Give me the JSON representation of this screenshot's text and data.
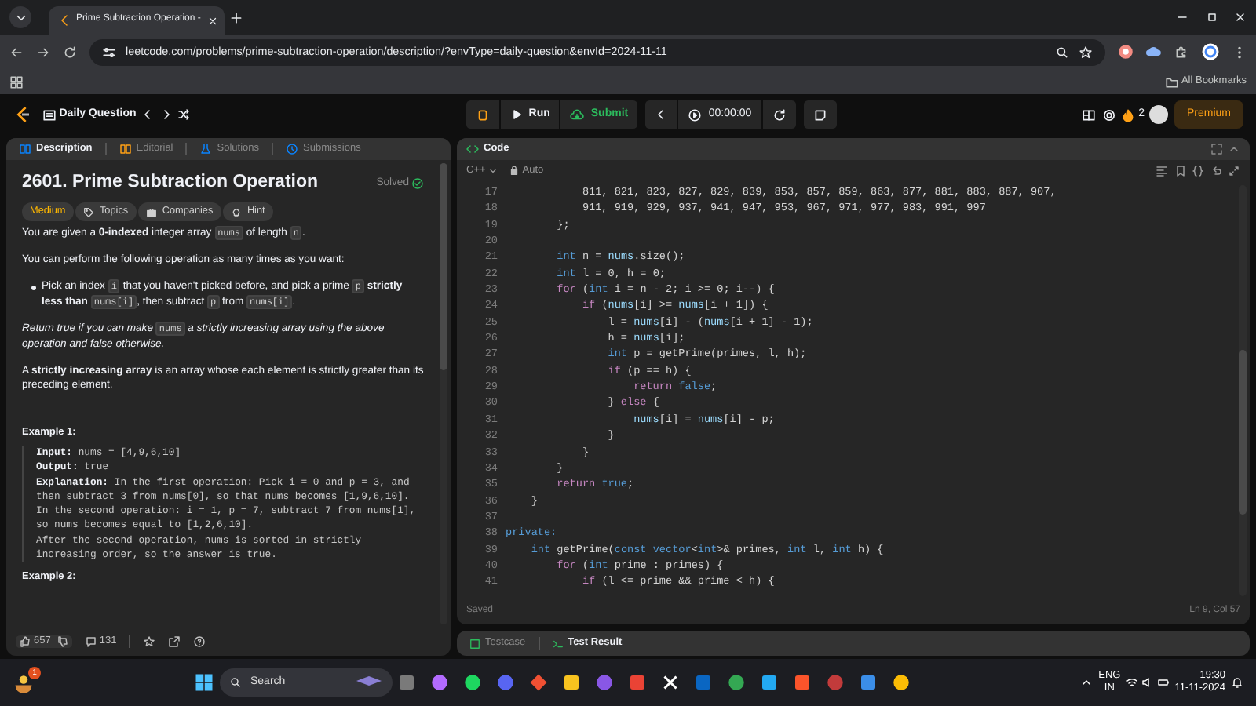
{
  "browser": {
    "tab_title": "Prime Subtraction Operation -",
    "url": "leetcode.com/problems/prime-subtraction-operation/description/?envType=daily-question&envId=2024-11-11",
    "bookmarks_label": "All Bookmarks"
  },
  "navbar": {
    "daily_question": "Daily Question",
    "run": "Run",
    "submit": "Submit",
    "timer": "00:00:00",
    "streak": "2",
    "premium": "Premium"
  },
  "description_panel": {
    "tabs": [
      {
        "label": "Description",
        "selected": true
      },
      {
        "label": "Editorial",
        "selected": false
      },
      {
        "label": "Solutions",
        "selected": false
      },
      {
        "label": "Submissions",
        "selected": false
      }
    ],
    "title": "2601. Prime Subtraction Operation",
    "status": "Solved",
    "tags": [
      {
        "label": "Medium",
        "kind": "difficulty"
      },
      {
        "label": "Topics",
        "kind": "topics"
      },
      {
        "label": "Companies",
        "kind": "companies"
      },
      {
        "label": "Hint",
        "kind": "hint"
      }
    ],
    "blocks": [
      {
        "kind": "paragraph",
        "segments": [
          {
            "kind": "text",
            "text": "You are given a "
          },
          {
            "kind": "bold",
            "text": "0-indexed"
          },
          {
            "kind": "text",
            "text": " integer array "
          },
          {
            "kind": "code",
            "text": "nums"
          },
          {
            "kind": "text",
            "text": " of length "
          },
          {
            "kind": "code",
            "text": "n"
          },
          {
            "kind": "text",
            "text": "."
          }
        ]
      },
      {
        "kind": "paragraph",
        "segments": [
          {
            "kind": "text",
            "text": "You can perform the following operation as many times as you want:"
          }
        ]
      },
      {
        "kind": "bullet",
        "segments": [
          {
            "kind": "text",
            "text": "Pick an index "
          },
          {
            "kind": "code",
            "text": "i"
          },
          {
            "kind": "text",
            "text": " that you haven't picked before, and pick a prime "
          },
          {
            "kind": "code",
            "text": "p"
          },
          {
            "kind": "bold",
            "text": " strictly less than "
          },
          {
            "kind": "code",
            "text": "nums[i]"
          },
          {
            "kind": "text",
            "text": ", then subtract "
          },
          {
            "kind": "code",
            "text": "p"
          },
          {
            "kind": "text",
            "text": " from "
          },
          {
            "kind": "code",
            "text": "nums[i]"
          },
          {
            "kind": "text",
            "text": "."
          }
        ]
      },
      {
        "kind": "paragraph",
        "segments": [
          {
            "kind": "italic",
            "text": "Return true if you can make "
          },
          {
            "kind": "code",
            "text": "nums"
          },
          {
            "kind": "italic",
            "text": " a strictly increasing array using the above operation and false otherwise."
          }
        ]
      },
      {
        "kind": "paragraph",
        "segments": [
          {
            "kind": "text",
            "text": "A "
          },
          {
            "kind": "bold",
            "text": "strictly increasing array"
          },
          {
            "kind": "text",
            "text": " is an array whose each element is strictly greater than its preceding element."
          }
        ]
      }
    ],
    "examples": [
      {
        "heading": "Example 1:",
        "lines": [
          {
            "label": "Input:",
            "text": "nums = [4,9,6,10]"
          },
          {
            "label": "Output:",
            "text": "true"
          },
          {
            "label": "Explanation:",
            "text": "In the first operation: Pick i = 0 and p = 3, and"
          },
          {
            "text": "then subtract 3 from nums[0], so that nums becomes [1,9,6,10]."
          },
          {
            "text": "In the second operation: i = 1, p = 7, subtract 7 from nums[1],"
          },
          {
            "text": "so nums becomes equal to [1,2,6,10]."
          },
          {
            "text": "After the second operation, nums is sorted in strictly"
          },
          {
            "text": "increasing order, so the answer is true."
          }
        ]
      },
      {
        "heading": "Example 2:"
      }
    ],
    "likes": "657",
    "comments": "131"
  },
  "editor": {
    "title": "Code",
    "language": "C++",
    "mode": "Auto",
    "status": "Saved",
    "cursor": "Ln 9, Col 57",
    "lines": [
      {
        "number": "17",
        "tokens": [
          {
            "kind": "plain",
            "text": "            811, 821, 823, 827, 829, 839, 853, 857, 859, 863, 877, 881, 883, 887, 907,"
          }
        ]
      },
      {
        "number": "18",
        "tokens": [
          {
            "kind": "plain",
            "text": "            911, 919, 929, 937, 941, 947, 953, 967, 971, 977, 983, 991, 997"
          }
        ]
      },
      {
        "number": "19",
        "tokens": [
          {
            "kind": "plain",
            "text": "        };"
          }
        ]
      },
      {
        "number": "20"
      },
      {
        "number": "21",
        "tokens": [
          {
            "kind": "type",
            "text": "        int"
          },
          {
            "kind": "plain",
            "text": " n = "
          },
          {
            "kind": "var",
            "text": "nums"
          },
          {
            "kind": "plain",
            "text": ".size();"
          }
        ]
      },
      {
        "number": "22",
        "tokens": [
          {
            "kind": "type",
            "text": "        int"
          },
          {
            "kind": "plain",
            "text": " l = 0, h = 0;"
          }
        ]
      },
      {
        "number": "23",
        "tokens": [
          {
            "kind": "control",
            "text": "        for"
          },
          {
            "kind": "plain",
            "text": " ("
          },
          {
            "kind": "type",
            "text": "int"
          },
          {
            "kind": "plain",
            "text": " i = n - 2; i >= 0; i--) {"
          }
        ]
      },
      {
        "number": "24",
        "tokens": [
          {
            "kind": "control",
            "text": "            if"
          },
          {
            "kind": "plain",
            "text": " ("
          },
          {
            "kind": "var",
            "text": "nums"
          },
          {
            "kind": "plain",
            "text": "[i] >= "
          },
          {
            "kind": "var",
            "text": "nums"
          },
          {
            "kind": "plain",
            "text": "[i + 1]) {"
          }
        ]
      },
      {
        "number": "25",
        "tokens": [
          {
            "kind": "plain",
            "text": "                l = "
          },
          {
            "kind": "var",
            "text": "nums"
          },
          {
            "kind": "plain",
            "text": "[i] - ("
          },
          {
            "kind": "var",
            "text": "nums"
          },
          {
            "kind": "plain",
            "text": "[i + 1] - 1);"
          }
        ]
      },
      {
        "number": "26",
        "tokens": [
          {
            "kind": "plain",
            "text": "                h = "
          },
          {
            "kind": "var",
            "text": "nums"
          },
          {
            "kind": "plain",
            "text": "[i];"
          }
        ]
      },
      {
        "number": "27",
        "tokens": [
          {
            "kind": "type",
            "text": "                int"
          },
          {
            "kind": "plain",
            "text": " p = getPrime(primes, l, h);"
          }
        ]
      },
      {
        "number": "28",
        "tokens": [
          {
            "kind": "control",
            "text": "                if"
          },
          {
            "kind": "plain",
            "text": " (p == h) {"
          }
        ]
      },
      {
        "number": "29",
        "tokens": [
          {
            "kind": "control",
            "text": "                    return"
          },
          {
            "kind": "type",
            "text": " false"
          },
          {
            "kind": "plain",
            "text": ";"
          }
        ]
      },
      {
        "number": "30",
        "tokens": [
          {
            "kind": "plain",
            "text": "                } "
          },
          {
            "kind": "control",
            "text": "else"
          },
          {
            "kind": "plain",
            "text": " {"
          }
        ]
      },
      {
        "number": "31",
        "tokens": [
          {
            "kind": "var",
            "text": "                    nums"
          },
          {
            "kind": "plain",
            "text": "[i] = "
          },
          {
            "kind": "var",
            "text": "nums"
          },
          {
            "kind": "plain",
            "text": "[i] - p;"
          }
        ]
      },
      {
        "number": "32",
        "tokens": [
          {
            "kind": "plain",
            "text": "                }"
          }
        ]
      },
      {
        "number": "33",
        "tokens": [
          {
            "kind": "plain",
            "text": "            }"
          }
        ]
      },
      {
        "number": "34",
        "tokens": [
          {
            "kind": "plain",
            "text": "        }"
          }
        ]
      },
      {
        "number": "35",
        "tokens": [
          {
            "kind": "control",
            "text": "        return"
          },
          {
            "kind": "type",
            "text": " true"
          },
          {
            "kind": "plain",
            "text": ";"
          }
        ]
      },
      {
        "number": "36",
        "tokens": [
          {
            "kind": "plain",
            "text": "    }"
          }
        ]
      },
      {
        "number": "37"
      },
      {
        "number": "38",
        "tokens": [
          {
            "kind": "type",
            "text": "private:"
          }
        ]
      },
      {
        "number": "39",
        "tokens": [
          {
            "kind": "type",
            "text": "    int"
          },
          {
            "kind": "plain",
            "text": " getPrime("
          },
          {
            "kind": "type",
            "text": "const vector"
          },
          {
            "kind": "plain",
            "text": "<"
          },
          {
            "kind": "type",
            "text": "int"
          },
          {
            "kind": "plain",
            "text": ">& primes, "
          },
          {
            "kind": "type",
            "text": "int"
          },
          {
            "kind": "plain",
            "text": " l, "
          },
          {
            "kind": "type",
            "text": "int"
          },
          {
            "kind": "plain",
            "text": " h) {"
          }
        ]
      },
      {
        "number": "40",
        "tokens": [
          {
            "kind": "control",
            "text": "        for"
          },
          {
            "kind": "plain",
            "text": " ("
          },
          {
            "kind": "type",
            "text": "int"
          },
          {
            "kind": "plain",
            "text": " prime : primes) {"
          }
        ]
      },
      {
        "number": "41",
        "tokens": [
          {
            "kind": "control",
            "text": "            if"
          },
          {
            "kind": "plain",
            "text": " (l <= prime && prime < h) {"
          }
        ]
      }
    ]
  },
  "bottom_tabs": [
    {
      "label": "Testcase",
      "selected": false
    },
    {
      "label": "Test Result",
      "selected": true
    }
  ],
  "taskbar": {
    "notification_count": "1",
    "search": "Search",
    "language": "ENG",
    "region": "IN",
    "time": "19:30",
    "date": "11-11-2024"
  }
}
